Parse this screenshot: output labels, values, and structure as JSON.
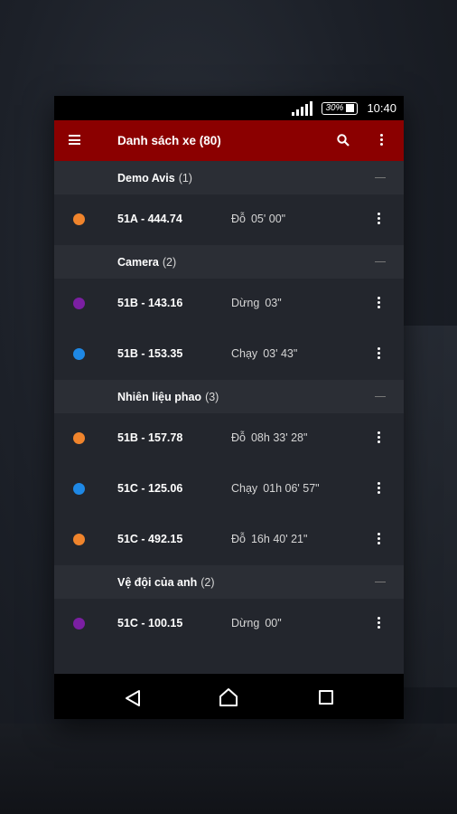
{
  "status_bar": {
    "battery": "30%",
    "time": "10:40"
  },
  "app_bar": {
    "title": "Danh sách xe (80)"
  },
  "colors": {
    "accent": "#8b0000",
    "orange": "#f0842c",
    "purple": "#7b1fa2",
    "blue": "#1e88e5"
  },
  "groups": [
    {
      "name": "Demo Avis",
      "count": "(1)",
      "vehicles": [
        {
          "plate": "51A - 444.74",
          "state": "Đỗ",
          "duration": "05' 00\"",
          "color": "orange"
        }
      ]
    },
    {
      "name": "Camera",
      "count": "(2)",
      "vehicles": [
        {
          "plate": "51B - 143.16",
          "state": "Dừng",
          "duration": "03\"",
          "color": "purple"
        },
        {
          "plate": "51B - 153.35",
          "state": "Chạy",
          "duration": "03' 43\"",
          "color": "blue"
        }
      ]
    },
    {
      "name": "Nhiên liệu phao",
      "count": "(3)",
      "vehicles": [
        {
          "plate": "51B - 157.78",
          "state": "Đỗ",
          "duration": "08h 33' 28\"",
          "color": "orange"
        },
        {
          "plate": "51C - 125.06",
          "state": "Chạy",
          "duration": "01h 06' 57\"",
          "color": "blue"
        },
        {
          "plate": "51C - 492.15",
          "state": "Đỗ",
          "duration": "16h 40' 21\"",
          "color": "orange"
        }
      ]
    },
    {
      "name": "Vệ đội của anh",
      "count": "(2)",
      "vehicles": [
        {
          "plate": "51C - 100.15",
          "state": "Dừng",
          "duration": "00\"",
          "color": "purple"
        }
      ]
    }
  ]
}
